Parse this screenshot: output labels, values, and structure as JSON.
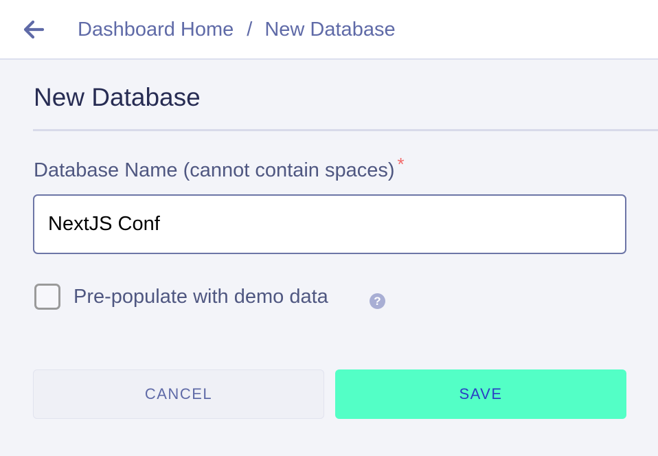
{
  "header": {
    "back_icon": "arrow-left-icon",
    "breadcrumb": {
      "home": "Dashboard Home",
      "separator": "/",
      "current": "New Database"
    }
  },
  "form": {
    "title": "New Database",
    "name_field": {
      "label": "Database Name (cannot contain spaces)",
      "required_marker": "*",
      "value": "NextJS Conf"
    },
    "demo_checkbox": {
      "label": "Pre-populate with demo data",
      "checked": false,
      "help_icon": "question-circle-icon",
      "help_glyph": "?"
    },
    "cancel_label": "CANCEL",
    "save_label": "SAVE"
  },
  "colors": {
    "accent": "#53ffc6",
    "link": "#5f6aa7",
    "required": "#f26a6a"
  }
}
